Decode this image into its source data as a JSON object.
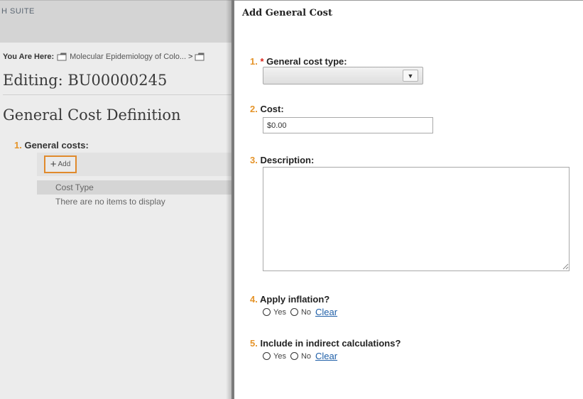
{
  "background": {
    "suite_label": "H SUITE",
    "breadcrumb": {
      "prefix": "You Are Here:",
      "item": "Molecular Epidemiology of Colo...",
      "separator": ">"
    },
    "editing_title": "Editing: BU00000245",
    "section_title": "General Cost Definition",
    "general_costs": {
      "number": "1.",
      "label": "General costs:",
      "add_label": "Add",
      "add_icon": "+",
      "column_header": "Cost Type",
      "empty_message": "There are no items to display"
    }
  },
  "dialog": {
    "title": "Add General Cost",
    "fields": {
      "cost_type": {
        "number": "1.",
        "required_mark": "*",
        "label": "General cost type:",
        "value": "",
        "dropdown_glyph": "▼"
      },
      "cost": {
        "number": "2.",
        "label": "Cost:",
        "value": "$0.00"
      },
      "description": {
        "number": "3.",
        "label": "Description:",
        "value": ""
      },
      "apply_inflation": {
        "number": "4.",
        "label": "Apply inflation?",
        "yes": "Yes",
        "no": "No",
        "clear": "Clear"
      },
      "indirect": {
        "number": "5.",
        "label": "Include in indirect calculations?",
        "yes": "Yes",
        "no": "No",
        "clear": "Clear"
      }
    }
  },
  "colors": {
    "accent_number": "#e5942a",
    "required": "#d9261c",
    "link": "#1f5fa8",
    "highlight_border": "#e08a2c"
  }
}
